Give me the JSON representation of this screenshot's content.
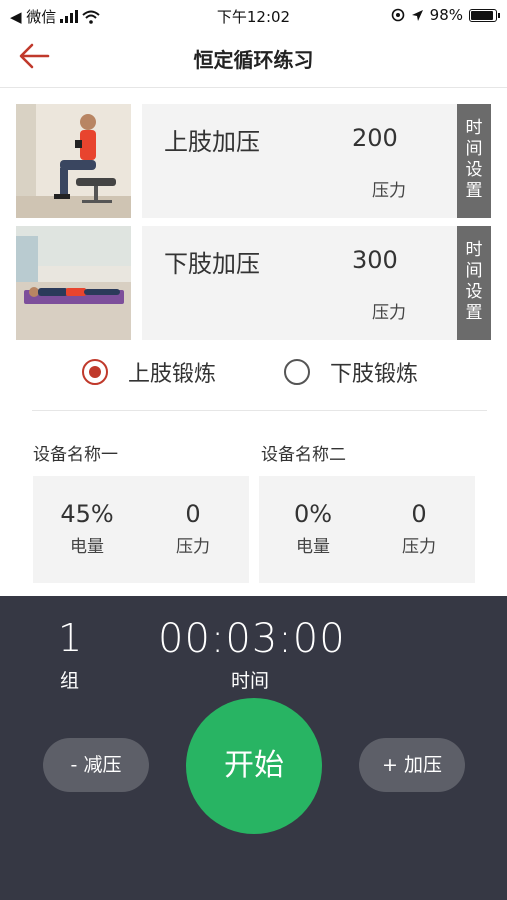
{
  "status_bar": {
    "carrier": "◀ 微信",
    "time": "下午12:02",
    "battery": "98%"
  },
  "nav": {
    "title": "恒定循环练习"
  },
  "exercises": [
    {
      "name": "上肢加压",
      "value": "200",
      "unit": "压力",
      "time_set": [
        "时",
        "间",
        "设",
        "置"
      ]
    },
    {
      "name": "下肢加压",
      "value": "300",
      "unit": "压力",
      "time_set": [
        "时",
        "间",
        "设",
        "置"
      ]
    }
  ],
  "mode": {
    "options": [
      "上肢锻炼",
      "下肢锻炼"
    ],
    "selected": 0
  },
  "devices": [
    {
      "name": "设备名称一",
      "battery": "45%",
      "battery_label": "电量",
      "pressure": "0",
      "pressure_label": "压力"
    },
    {
      "name": "设备名称二",
      "battery": "0%",
      "battery_label": "电量",
      "pressure": "0",
      "pressure_label": "压力"
    }
  ],
  "control": {
    "group_value": "1",
    "group_label": "组",
    "time_value": "00:03:00",
    "time_label": "时间",
    "decrease_label": "- 减压",
    "start_label": "开始",
    "increase_label": "+ 加压"
  },
  "colors": {
    "accent_red": "#c0392b",
    "start_green": "#28b463",
    "panel_dark": "#363844"
  }
}
